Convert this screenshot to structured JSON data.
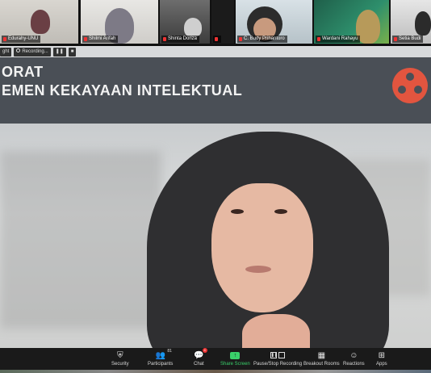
{
  "gallery": {
    "tiles": [
      {
        "name": "Edurahy-UNU"
      },
      {
        "name": "Shilmi Arifah"
      },
      {
        "name": "Shinta Doriza"
      },
      {
        "name": ""
      },
      {
        "name": "C. Budy Prihantoro"
      },
      {
        "name": "Wardani Rahayu"
      },
      {
        "name": "Setia Budi"
      }
    ]
  },
  "recording": {
    "left_label": "ght",
    "status": "Recording..."
  },
  "banner": {
    "line1": "ORAT",
    "line2": "EMEN KEKAYAAN INTELEKTUAL",
    "logo_color": "#e2553f"
  },
  "toolbar": {
    "items": [
      {
        "label": "Security",
        "icon": "shield-icon"
      },
      {
        "label": "Participants",
        "icon": "participants-icon",
        "count": "81"
      },
      {
        "label": "Chat",
        "icon": "chat-icon",
        "badge": "4"
      },
      {
        "label": "Share Screen",
        "icon": "share-screen-icon"
      },
      {
        "label": "Pause/Stop Recording",
        "icon": "pause-stop-icon"
      },
      {
        "label": "Breakout Rooms",
        "icon": "breakout-rooms-icon"
      },
      {
        "label": "Reactions",
        "icon": "reactions-icon"
      },
      {
        "label": "Apps",
        "icon": "apps-icon"
      }
    ],
    "share_color": "#3ad06b"
  }
}
